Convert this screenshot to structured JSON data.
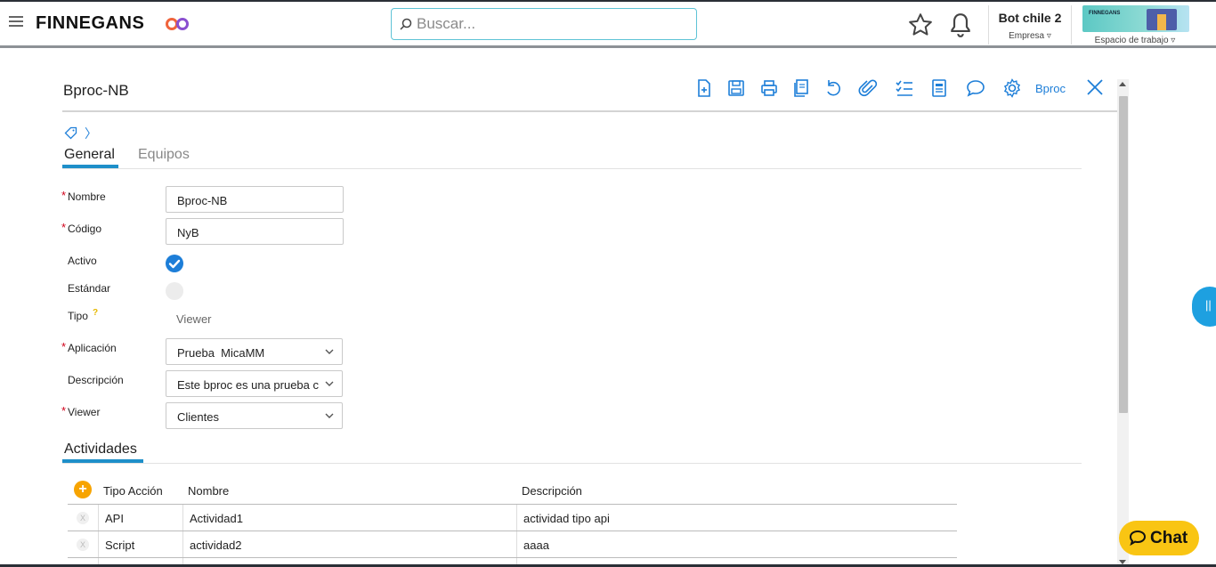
{
  "header": {
    "logo_text": "FINNEGANS",
    "search_placeholder": "Buscar...",
    "company_name": "Bot chile 2",
    "company_sub": "Empresa ▿",
    "workspace_sub": "Espacio de trabajo ▿",
    "workspace_logo": "FINNEGANS"
  },
  "form": {
    "title": "Bproc-NB",
    "toolbar_link": "Bproc",
    "tabs": [
      "General",
      "Equipos"
    ],
    "labels": {
      "nombre": "Nombre",
      "codigo": "Código",
      "activo": "Activo",
      "estandar": "Estándar",
      "tipo": "Tipo",
      "aplicacion": "Aplicación",
      "descripcion": "Descripción",
      "viewer": "Viewer"
    },
    "values": {
      "nombre": "Bproc-NB",
      "codigo": "NyB",
      "activo": true,
      "estandar": false,
      "tipo": "Viewer",
      "aplicacion": "Prueba  MicaMM",
      "descripcion": "Este bproc es una prueba c",
      "viewer": "Clientes"
    },
    "required_mark": "*"
  },
  "activities": {
    "title": "Actividades",
    "columns": [
      "Tipo Acción",
      "Nombre",
      "Descripción"
    ],
    "delete_mark": "X",
    "rows": [
      {
        "tipo": "API",
        "nombre": "Actividad1",
        "descripcion": "actividad tipo api"
      },
      {
        "tipo": "Script",
        "nombre": "actividad2",
        "descripcion": "aaaa"
      }
    ]
  },
  "side_tab_label": "||",
  "chat": {
    "label": "Chat",
    "color": "#f9c513"
  },
  "colors": {
    "accent": "#1d7ed8",
    "tab_underline": "#1e8fc9",
    "add_button": "#f7a400"
  }
}
